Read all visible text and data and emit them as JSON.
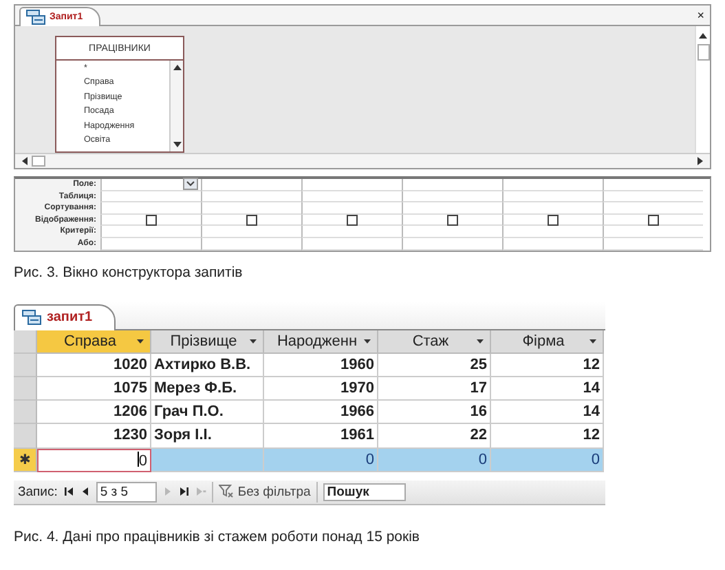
{
  "design_window": {
    "tab_title": "Запит1",
    "close": "×",
    "field_list": {
      "title": "ПРАЦІВНИКИ",
      "fields": [
        "*",
        "Справа",
        "Прізвище",
        "Посада",
        "Народження",
        "Освіта"
      ]
    },
    "grid": {
      "row_labels": [
        "Поле:",
        "Таблиця:",
        "Сортування:",
        "Відображення:",
        "Критерії:",
        "Або:"
      ],
      "columns": [
        {
          "selected": true,
          "show": false
        },
        {
          "selected": false,
          "show": false
        },
        {
          "selected": false,
          "show": false
        },
        {
          "selected": false,
          "show": false
        },
        {
          "selected": false,
          "show": false
        },
        {
          "selected": false,
          "show": false
        }
      ]
    }
  },
  "figure_3_caption": "Рис. 3. Вікно конструктора запитів",
  "datasheet": {
    "tab_title": "запит1",
    "columns": [
      {
        "label": "Справа",
        "selected": true,
        "kind": "number"
      },
      {
        "label": "Прізвище",
        "selected": false,
        "kind": "text"
      },
      {
        "label": "Народженн",
        "selected": false,
        "kind": "number"
      },
      {
        "label": "Стаж",
        "selected": false,
        "kind": "number"
      },
      {
        "label": "Фірма",
        "selected": false,
        "kind": "number"
      }
    ],
    "rows": [
      {
        "cells": [
          "1020",
          "Ахтирко В.В.",
          "1960",
          "25",
          "12"
        ]
      },
      {
        "cells": [
          "1075",
          "Мерез Ф.Б.",
          "1970",
          "17",
          "14"
        ]
      },
      {
        "cells": [
          "1206",
          "Грач П.О.",
          "1966",
          "16",
          "14"
        ]
      },
      {
        "cells": [
          "1230",
          "Зоря І.І.",
          "1961",
          "22",
          "12"
        ]
      }
    ],
    "new_row": {
      "marker": "✱",
      "selected": true,
      "cells": [
        "0",
        "",
        "0",
        "0",
        "0"
      ]
    },
    "navigator": {
      "label": "Запис:",
      "position": "5 з 5",
      "filter": "Без фільтра",
      "search_placeholder": "Пошук",
      "buttons": [
        {
          "kind": "first",
          "disabled": false
        },
        {
          "kind": "prev",
          "disabled": false
        },
        {
          "kind": "next",
          "disabled": true
        },
        {
          "kind": "last",
          "disabled": false
        },
        {
          "kind": "new",
          "disabled": true
        }
      ]
    }
  },
  "figure_4_caption": "Рис. 4. Дані про працівників зі стажем роботи понад 15 років"
}
